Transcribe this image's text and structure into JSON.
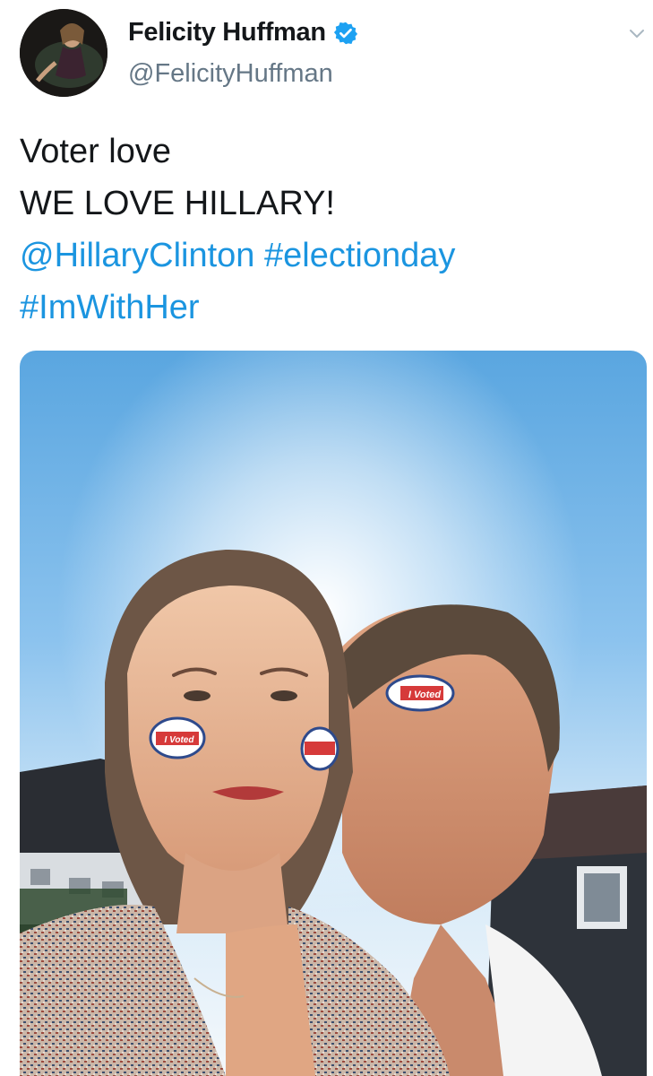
{
  "author": {
    "display_name": "Felicity Huffman",
    "handle": "@FelicityHuffman",
    "verified": true
  },
  "icons": {
    "verified": "verified-badge-icon",
    "more": "chevron-down-icon"
  },
  "tweet": {
    "lines": [
      {
        "text": "Voter love"
      },
      {
        "text": "WE LOVE HILLARY!"
      }
    ],
    "mention": "@HillaryClinton",
    "hashtag_1": "#electionday",
    "hashtag_2": "#ImWithHer"
  },
  "media": {
    "sticker_label": "I Voted"
  },
  "colors": {
    "link": "#1b95e0",
    "verified": "#1da1f2",
    "handle": "#657786",
    "text": "#14171a"
  }
}
